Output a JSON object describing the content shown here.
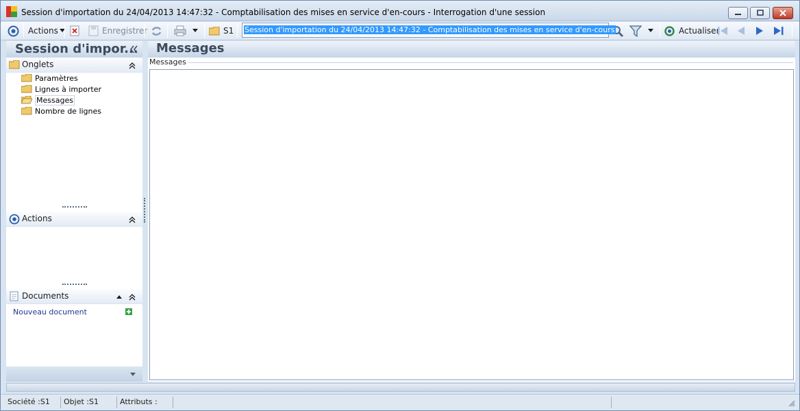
{
  "window": {
    "title": "Session d'importation du 24/04/2013 14:47:32 - Comptabilisation des mises en service d'en-cours -  Interrogation d'une session"
  },
  "toolbar": {
    "actions_label": "Actions",
    "save_label": "Enregistrer",
    "company_label": "S1",
    "search_value": "Session d'importation du 24/04/2013 14:47:32 - Comptabilisation des mises en service d'en-cours",
    "refresh_label": "Actualiser"
  },
  "left_panel": {
    "title": "Session d'impor...",
    "tabs_section": {
      "title": "Onglets",
      "items": [
        {
          "label": "Paramètres"
        },
        {
          "label": "Lignes à importer"
        },
        {
          "label": "Messages"
        },
        {
          "label": "Nombre de lignes"
        }
      ]
    },
    "actions_section": {
      "title": "Actions"
    },
    "documents_section": {
      "title": "Documents",
      "new_document_label": "Nouveau document"
    }
  },
  "main": {
    "title": "Messages",
    "group_label": "Messages"
  },
  "statusbar": {
    "company": "Société :S1",
    "object": "Objet :S1",
    "attributes": "Attributs :"
  },
  "colors": {
    "accent": "#3399ff",
    "link": "#1f3a8f",
    "header_text": "#3b4a5c",
    "close_button": "#c0392b"
  }
}
